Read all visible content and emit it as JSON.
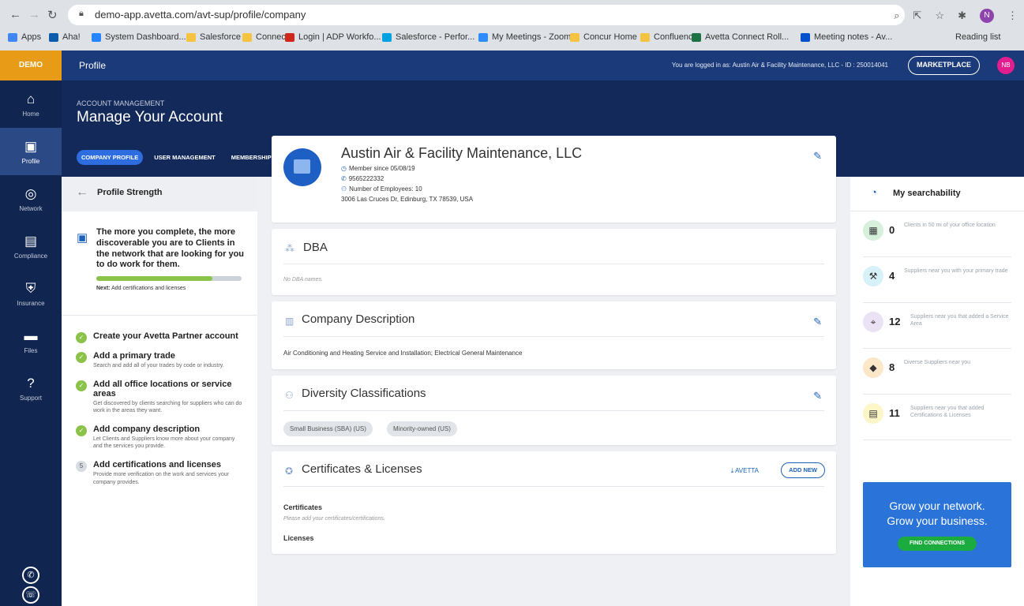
{
  "browser": {
    "url": "demo-app.avetta.com/avt-sup/profile/company",
    "profile_initial": "N",
    "bookmarks": [
      {
        "label": "Apps",
        "color": "#4285f4"
      },
      {
        "label": "Aha!",
        "color": "#0b5cad"
      },
      {
        "label": "System Dashboard...",
        "color": "#2684ff"
      },
      {
        "label": "Salesforce",
        "color": "#f5c242"
      },
      {
        "label": "Connect",
        "color": "#f5c242"
      },
      {
        "label": "Login | ADP Workfo...",
        "color": "#d0271d"
      },
      {
        "label": "Salesforce - Perfor...",
        "color": "#00a1e0"
      },
      {
        "label": "My Meetings - Zoom",
        "color": "#2d8cff"
      },
      {
        "label": "Concur Home",
        "color": "#f5c242"
      },
      {
        "label": "Confluence",
        "color": "#f5c242"
      },
      {
        "label": "Avetta Connect Roll...",
        "color": "#1e7145"
      },
      {
        "label": "Meeting notes - Av...",
        "color": "#0052cc"
      }
    ],
    "reading_list": "Reading list"
  },
  "nav": {
    "demo_label": "DEMO",
    "items": [
      {
        "label": "Home",
        "icon": "home-icon",
        "glyph": "⌂"
      },
      {
        "label": "Profile",
        "icon": "monitor-icon",
        "glyph": "▣"
      },
      {
        "label": "Network",
        "icon": "network-icon",
        "glyph": "◎"
      },
      {
        "label": "Compliance",
        "icon": "clipboard-icon",
        "glyph": "▤"
      },
      {
        "label": "Insurance",
        "icon": "shield-icon",
        "glyph": "⛨"
      },
      {
        "label": "Files",
        "icon": "folder-icon",
        "glyph": "▬"
      },
      {
        "label": "Support",
        "icon": "help-icon",
        "glyph": "?"
      }
    ]
  },
  "topbar": {
    "title": "Profile",
    "logged_in": "You are logged in as: Austin Air & Facility Maintenance, LLC - ID : 250014041",
    "marketplace": "MARKETPLACE",
    "user_initials": "NB"
  },
  "header": {
    "eyebrow": "ACCOUNT MANAGEMENT",
    "title": "Manage Your Account",
    "tabs": [
      "COMPANY PROFILE",
      "USER MANAGEMENT",
      "MEMBERSHIP"
    ]
  },
  "profile_strength": {
    "title": "Profile Strength",
    "intro": "The more you complete, the more discoverable you are to Clients in the network that are looking for you to do work for them.",
    "progress": 0.8,
    "next_prefix": "Next:",
    "next_text": " Add certifications and licenses",
    "steps": [
      {
        "title": "Create your Avetta Partner account",
        "desc": "",
        "done": true,
        "mark": "✓"
      },
      {
        "title": "Add a primary trade",
        "desc": "Search and add all of your trades by code or industry.",
        "done": true,
        "mark": "✓"
      },
      {
        "title": "Add all office locations or service areas",
        "desc": "Get discovered by clients searching for suppliers who can do work in the areas they want.",
        "done": true,
        "mark": "✓"
      },
      {
        "title": "Add company description",
        "desc": "Let Clients and Suppliers know more about your company and the services you provide.",
        "done": true,
        "mark": "✓"
      },
      {
        "title": "Add certifications and licenses",
        "desc": "Provide more verification on the work and services your company provides.",
        "done": false,
        "mark": "5"
      }
    ]
  },
  "company": {
    "name": "Austin Air & Facility Maintenance, LLC",
    "member_since": "Member since 05/08/19",
    "phone": "9565222332",
    "employees": "Number of Employees: 10",
    "address": "3006 Las Cruces Dr, Edinburg, TX 78539, USA"
  },
  "dba": {
    "title": "DBA",
    "empty": "No DBA names."
  },
  "description": {
    "title": "Company Description",
    "body": "Air Conditioning and Heating Service and Installation; Electrical General Maintenance"
  },
  "diversity": {
    "title": "Diversity Classifications",
    "tags": [
      "Small Business (SBA) (US)",
      "Minority-owned (US)"
    ]
  },
  "certificates": {
    "title": "Certificates & Licenses",
    "download_label": "AVETTA",
    "add_new": "ADD NEW",
    "certs_heading": "Certificates",
    "certs_empty": "Please add your certificates/certifications.",
    "licenses_heading": "Licenses"
  },
  "searchability": {
    "title": "My searchability",
    "items": [
      {
        "count": "0",
        "label": "Clients in 50 mi of your office location",
        "color": "#d7f0dc",
        "glyph": "▦"
      },
      {
        "count": "4",
        "label": "Suppliers near you with your primary trade",
        "color": "#d6f1f8",
        "glyph": "⚒"
      },
      {
        "count": "12",
        "label": "Suppliers near you that added a Service Area",
        "color": "#ebe3f5",
        "glyph": "⌖"
      },
      {
        "count": "8",
        "label": "Diverse Suppliers near you",
        "color": "#fde7c9",
        "glyph": "◆"
      },
      {
        "count": "11",
        "label": "Suppliers near you that added Certifications & Licenses",
        "color": "#fdf6c6",
        "glyph": "▤"
      }
    ]
  },
  "promo": {
    "line1": "Grow your network.",
    "line2": "Grow your business.",
    "button": "FIND CONNECTIONS"
  }
}
